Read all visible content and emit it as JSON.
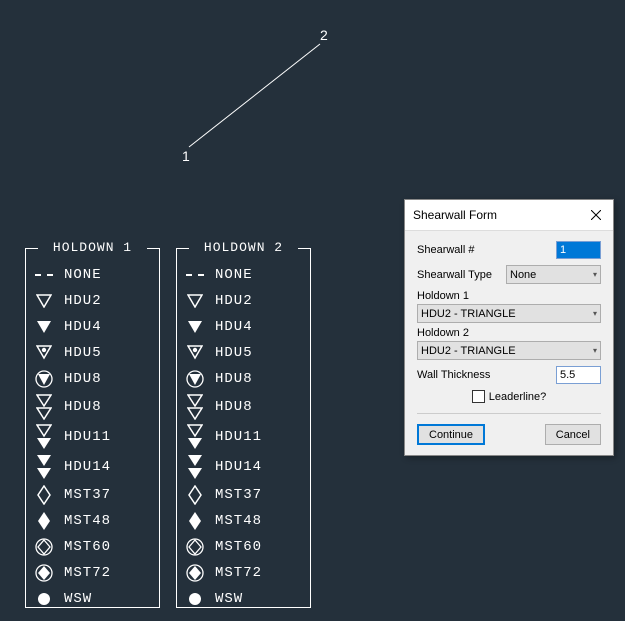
{
  "canvas": {
    "label1": "1",
    "label2": "2"
  },
  "legend1": {
    "title": "HOLDOWN 1",
    "items": [
      {
        "symbol": "none",
        "label": "NONE"
      },
      {
        "symbol": "tri-open",
        "label": "HDU2"
      },
      {
        "symbol": "tri-fill",
        "label": "HDU4"
      },
      {
        "symbol": "tri-dot",
        "label": "HDU5"
      },
      {
        "symbol": "tri-fill-circ",
        "label": "HDU8"
      },
      {
        "symbol": "dbl-tri-open",
        "label": "HDU8"
      },
      {
        "symbol": "dbl-tri-mix",
        "label": "HDU11"
      },
      {
        "symbol": "dbl-tri-fill",
        "label": "HDU14"
      },
      {
        "symbol": "diam-open",
        "label": "MST37"
      },
      {
        "symbol": "diam-fill",
        "label": "MST48"
      },
      {
        "symbol": "circ-diam",
        "label": "MST60"
      },
      {
        "symbol": "circ-diam-fill",
        "label": "MST72"
      },
      {
        "symbol": "circ-fill",
        "label": "WSW"
      }
    ]
  },
  "legend2": {
    "title": "HOLDOWN 2",
    "items": [
      {
        "symbol": "none",
        "label": "NONE"
      },
      {
        "symbol": "tri-open",
        "label": "HDU2"
      },
      {
        "symbol": "tri-fill",
        "label": "HDU4"
      },
      {
        "symbol": "tri-dot",
        "label": "HDU5"
      },
      {
        "symbol": "tri-fill-circ",
        "label": "HDU8"
      },
      {
        "symbol": "dbl-tri-open",
        "label": "HDU8"
      },
      {
        "symbol": "dbl-tri-mix",
        "label": "HDU11"
      },
      {
        "symbol": "dbl-tri-fill",
        "label": "HDU14"
      },
      {
        "symbol": "diam-open",
        "label": "MST37"
      },
      {
        "symbol": "diam-fill",
        "label": "MST48"
      },
      {
        "symbol": "circ-diam",
        "label": "MST60"
      },
      {
        "symbol": "circ-diam-fill",
        "label": "MST72"
      },
      {
        "symbol": "circ-fill",
        "label": "WSW"
      }
    ]
  },
  "dialog": {
    "title": "Shearwall Form",
    "shearwall_num_label": "Shearwall #",
    "shearwall_num_value": "1",
    "shearwall_type_label": "Shearwall Type",
    "shearwall_type_value": "None",
    "holdown1_label": "Holdown 1",
    "holdown1_value": "HDU2 - TRIANGLE",
    "holdown2_label": "Holdown 2",
    "holdown2_value": "HDU2 - TRIANGLE",
    "wall_thickness_label": "Wall Thickness",
    "wall_thickness_value": "5.5",
    "leaderline_label": "Leaderline?",
    "continue_label": "Continue",
    "cancel_label": "Cancel"
  }
}
